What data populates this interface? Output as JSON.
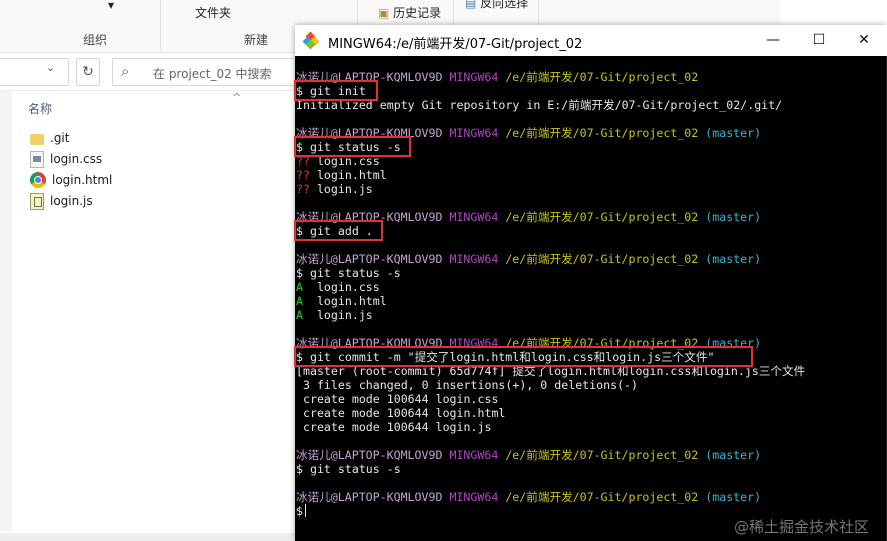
{
  "explorer": {
    "ribbon": {
      "file_clip": "文件夹",
      "history": "历史记录",
      "reverse_select": "反向选择",
      "group_organize": "组织",
      "group_new": "新建"
    },
    "search_placeholder": "在 project_02 中搜索",
    "column_name": "名称",
    "files": [
      {
        "name": ".git",
        "icon": "folder-icon"
      },
      {
        "name": "login.css",
        "icon": "css-file-icon"
      },
      {
        "name": "login.html",
        "icon": "chrome-icon"
      },
      {
        "name": "login.js",
        "icon": "js-file-icon"
      }
    ]
  },
  "terminal": {
    "title": "MINGW64:/e/前端开发/07-Git/project_02",
    "buttons": {
      "minimize": "—",
      "maximize": "☐",
      "close": "✕"
    },
    "prompt": {
      "user": "冰诺儿@LAPTOP-KQMLOV9D",
      "shell": "MINGW64",
      "path": "/e/前端开发/07-Git/project_02",
      "branch": "(master)"
    },
    "lines": {
      "cmd1": "$ git init",
      "out1": "Initialized empty Git repository in E:/前端开发/07-Git/project_02/.git/",
      "cmd2": "$ git status -s",
      "st_prefix": "??",
      "st1": " login.css",
      "st2": " login.html",
      "st3": " login.js",
      "cmd3": "$ git add .",
      "cmd4": "$ git status -s",
      "a_prefix": "A",
      "a1": "  login.css",
      "a2": "  login.html",
      "a3": "  login.js",
      "cmd5": "$ git commit -m \"提交了login.html和login.css和login.js三个文件\"",
      "out5a": "[master (root-commit) 65d774f] 提交了login.html和login.css和login.js三个文件",
      "out5b": " 3 files changed, 0 insertions(+), 0 deletions(-)",
      "out5c": " create mode 100644 login.css",
      "out5d": " create mode 100644 login.html",
      "out5e": " create mode 100644 login.js",
      "cmd6": "$ git status -s",
      "cmd7": "$"
    },
    "watermark": "@稀土掘金技术社区"
  },
  "colors": {
    "highlight_box": "#e0303a",
    "prompt_user": "#c5a0d3",
    "prompt_shell": "#b043c0",
    "prompt_path": "#c6c21f",
    "prompt_branch": "#35b5d6",
    "status_untracked": "#e0383a",
    "status_added": "#1ccb33"
  }
}
